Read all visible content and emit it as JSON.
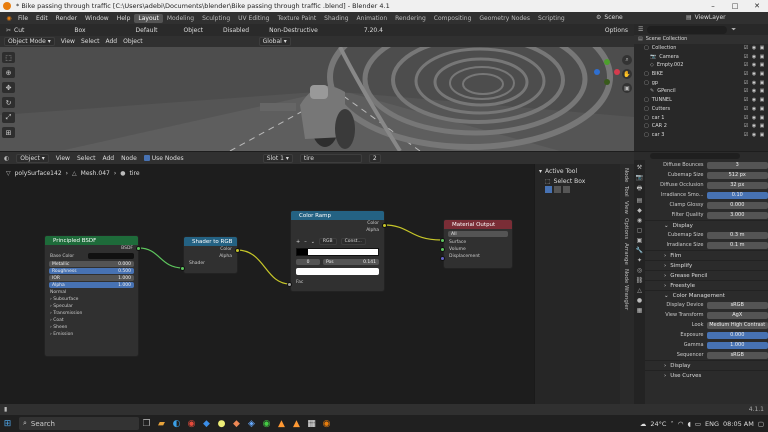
{
  "window": {
    "title": "* Bike passing through traffic  [C:\\Users\\adebi\\Documents\\blender\\Bike passing through traffic .blend] - Blender 4.1",
    "controls": [
      "–",
      "□",
      "✕"
    ]
  },
  "menu": {
    "items": [
      "File",
      "Edit",
      "Render",
      "Window",
      "Help"
    ],
    "workspaces": [
      "Layout",
      "Modeling",
      "Sculpting",
      "UV Editing",
      "Texture Paint",
      "Shading",
      "Animation",
      "Rendering",
      "Compositing",
      "Geometry Nodes",
      "Scripting"
    ],
    "active_workspace": "Layout",
    "scene_label": "Scene",
    "viewlayer_label": "ViewLayer"
  },
  "tool_header": {
    "cut": "Cut",
    "box": "Box",
    "default": "Default",
    "object": "Object",
    "disabled": "Disabled",
    "non_destructive": "Non-Destructive",
    "value": "7.20.4",
    "options": "Options"
  },
  "viewport_header": {
    "mode": "Object Mode",
    "view": "View",
    "select": "Select",
    "add": "Add",
    "object": "Object",
    "orientation": "Global"
  },
  "node_header": {
    "type": "Object",
    "view": "View",
    "select": "Select",
    "add": "Add",
    "node": "Node",
    "use_nodes": "Use Nodes",
    "slot": "Slot 1",
    "material": "tire",
    "users": "2"
  },
  "breadcrumb": {
    "object": "polySurface142",
    "mesh": "Mesh.047",
    "material": "tire"
  },
  "nodes": {
    "principled": {
      "title": "Principled BSDF",
      "output": "BSDF",
      "base_color": "Base Color",
      "metallic": "Metallic",
      "metallic_val": "0.000",
      "roughness": "Roughness",
      "roughness_val": "0.500",
      "ior": "IOR",
      "ior_val": "1.000",
      "alpha": "Alpha",
      "alpha_val": "1.000",
      "normal": "Normal",
      "panels": [
        "Subsurface",
        "Specular",
        "Transmission",
        "Coat",
        "Sheen",
        "Emission"
      ]
    },
    "shader_rgb": {
      "title": "Shader to RGB",
      "color": "Color",
      "alpha": "Alpha",
      "shader": "Shader"
    },
    "color_ramp": {
      "title": "Color Ramp",
      "color": "Color",
      "alpha": "Alpha",
      "mode": "RGB",
      "interp": "Const...",
      "index": "0",
      "pos_label": "Pos",
      "pos_val": "0.141",
      "fac": "Fac"
    },
    "output": {
      "title": "Material Output",
      "target": "All",
      "surface": "Surface",
      "volume": "Volume",
      "displacement": "Displacement"
    }
  },
  "npanel": {
    "title": "Active Tool",
    "tool": "Select Box"
  },
  "ntabs": [
    "Node",
    "Tool",
    "View",
    "Options",
    "Arrange",
    "Node Wrangler"
  ],
  "outliner": {
    "search_placeholder": "",
    "rows": [
      {
        "label": "Scene Collection",
        "indent": 0
      },
      {
        "label": "Collection",
        "indent": 1
      },
      {
        "label": "Camera",
        "indent": 2
      },
      {
        "label": "Empty.002",
        "indent": 2
      },
      {
        "label": "BIKE",
        "indent": 1
      },
      {
        "label": "gp",
        "indent": 1
      },
      {
        "label": "GPencil",
        "indent": 2
      },
      {
        "label": "TUNNEL",
        "indent": 1
      },
      {
        "label": "Cutters",
        "indent": 1
      },
      {
        "label": "car 1",
        "indent": 1
      },
      {
        "label": "CAR 2",
        "indent": 1
      },
      {
        "label": "car 3",
        "indent": 1
      }
    ]
  },
  "properties": {
    "rows": [
      {
        "label": "Diffuse Bounces",
        "value": "3"
      },
      {
        "label": "Cubemap Size",
        "value": "512 px"
      },
      {
        "label": "Diffuse Occlusion",
        "value": "32 px"
      },
      {
        "label": "Irradiance Smo...",
        "value": "0.10",
        "blue": true
      },
      {
        "label": "Clamp Glossy",
        "value": "0.000"
      },
      {
        "label": "Filter Quality",
        "value": "3.000"
      }
    ],
    "display_label": "Display",
    "display_rows": [
      {
        "label": "Cubemap Size",
        "value": "0.3 m"
      },
      {
        "label": "Irradiance Size",
        "value": "0.1 m"
      }
    ],
    "sections": [
      "Film",
      "Simplify",
      "Grease Pencil",
      "Freestyle"
    ],
    "cm_label": "Color Management",
    "cm_rows": [
      {
        "label": "Display Device",
        "value": "sRGB"
      },
      {
        "label": "View Transform",
        "value": "AgX"
      },
      {
        "label": "Look",
        "value": "Medium High Contrast"
      },
      {
        "label": "Exposure",
        "value": "0.000",
        "blue": true
      },
      {
        "label": "Gamma",
        "value": "1.000",
        "blue": true
      },
      {
        "label": "Sequencer",
        "value": "sRGB"
      }
    ],
    "display2": "Display",
    "use_curves": "Use Curves"
  },
  "status": {
    "version": "4.1.1"
  },
  "taskbar": {
    "search": "Search",
    "temp": "24°C",
    "time": "08:05 AM",
    "lang": "ENG"
  },
  "colors": {
    "principled_header": "#1e6b3a",
    "shader_header": "#246283",
    "ramp_header": "#246283",
    "output_header": "#7a2d36",
    "accent": "#4772b3"
  }
}
